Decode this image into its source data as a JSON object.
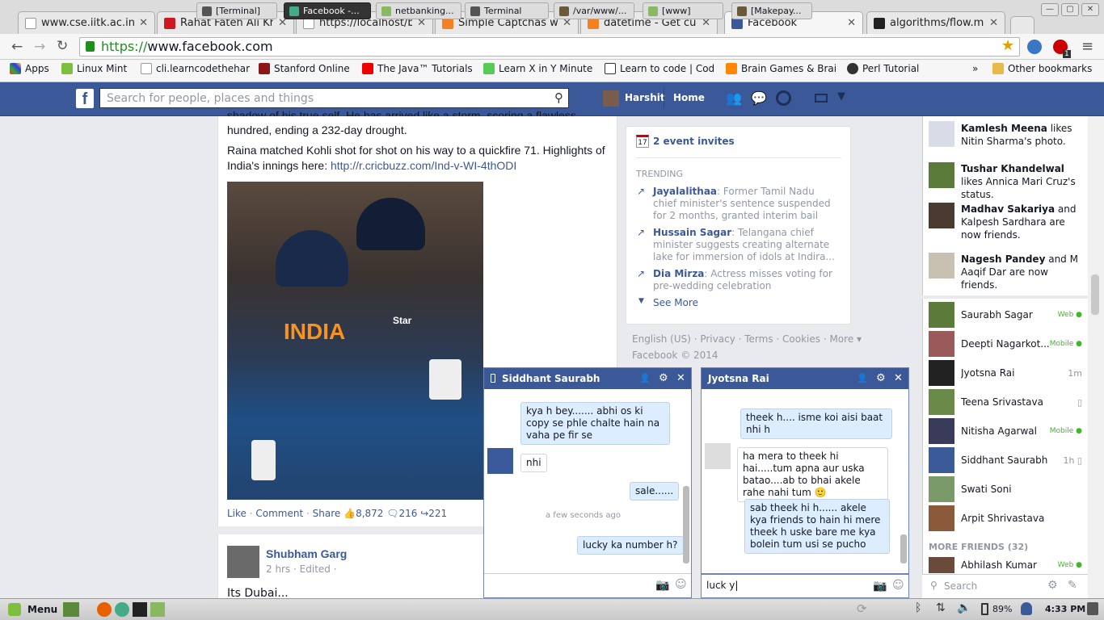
{
  "browser": {
    "tabs": [
      {
        "title": "www.cse.iitk.ac.in/u",
        "icon": "page-icon",
        "color": "#ffffff"
      },
      {
        "title": "Rahat Fateh Ali Khar",
        "icon": "youtube-icon",
        "color": "#cc181e"
      },
      {
        "title": "https://localhost/bar",
        "icon": "page-icon",
        "color": "#ffffff"
      },
      {
        "title": "Simple Captchas wit",
        "icon": "stackoverflow-icon",
        "color": "#f48024"
      },
      {
        "title": "datetime - Get curre",
        "icon": "stackoverflow-icon",
        "color": "#f48024"
      },
      {
        "title": "Facebook",
        "icon": "facebook-icon",
        "color": "#3b5998"
      },
      {
        "title": "algorithms/flow.mar",
        "icon": "github-icon",
        "color": "#222222"
      }
    ],
    "url_scheme": "https://",
    "url_host": "www.facebook.com",
    "bookmarks": [
      {
        "label": "Apps"
      },
      {
        "label": "Linux Mint"
      },
      {
        "label": "cli.learncodethehar"
      },
      {
        "label": "Stanford Online"
      },
      {
        "label": "The Java™ Tutorials"
      },
      {
        "label": "Learn X in Y Minute"
      },
      {
        "label": "Learn to code | Cod"
      },
      {
        "label": "Brain Games & Brai"
      },
      {
        "label": "Perl Tutorial"
      },
      {
        "label": "»"
      },
      {
        "label": "Other bookmarks"
      }
    ],
    "extension_badge": "1"
  },
  "fb_header": {
    "search_placeholder": "Search for people, places and things",
    "user_name": "Harshit",
    "home_label": "Home"
  },
  "post": {
    "partial_line1": "shadow of his true self. He has arrived like a storm, scoring a flawless",
    "partial_line2": "hundred, ending a 232-day drought.",
    "para2": "Raina matched Kohli shot for shot on his way to a quickfire 71. Highlights of India's innings here: ",
    "link": "http://r.cricbuzz.com/Ind-v-WI-4thODI",
    "like": "Like",
    "comment": "Comment",
    "share": "Share",
    "likes_count": "8,872",
    "comments_count": "216",
    "shares_count": "221",
    "jersey_text": "INDIA",
    "jersey_sponsor": "Star"
  },
  "next_post": {
    "author": "Shubham Garg",
    "meta": "2 hrs · Edited ·",
    "text": "Its Dubai..."
  },
  "right_col": {
    "event_date": "17",
    "event_invites": "2 event invites",
    "trending_title": "TRENDING",
    "trends": [
      {
        "name": "Jayalalithaa",
        "text": ": Former Tamil Nadu chief minister's sentence suspended for 2 months, granted interim bail"
      },
      {
        "name": "Hussain Sagar",
        "text": ": Telangana chief minister suggests creating alternate lake for immersion of idols at Indira..."
      },
      {
        "name": "Dia Mirza",
        "text": ": Actress misses voting for pre-wedding celebration"
      }
    ],
    "see_more": "See More",
    "footer_links": "English (US) · Privacy · Terms · Cookies · More ▾",
    "copyright": "Facebook © 2014"
  },
  "ticker": [
    {
      "name": "Kamlesh Meena",
      "text": " likes Nitin Sharma's photo."
    },
    {
      "name": "Tushar Khandelwal",
      "text": " likes Annica Mari Cruz's status."
    },
    {
      "name": "Madhav Sakariya",
      "text": " and Kalpesh Sardhara are now friends."
    },
    {
      "name": "Nagesh Pandey",
      "text": " and M Aaqif Dar are now friends."
    }
  ],
  "friends": [
    {
      "name": "Saurabh Sagar",
      "status": "Web ●",
      "grey": false
    },
    {
      "name": "Deepti Nagarkot...",
      "status": "Mobile ●",
      "grey": false
    },
    {
      "name": "Jyotsna Rai",
      "status": "1m",
      "grey": true
    },
    {
      "name": "Teena Srivastava",
      "status": "▯",
      "grey": true
    },
    {
      "name": "Nitisha Agarwal",
      "status": "Mobile ●",
      "grey": false
    },
    {
      "name": "Siddhant Saurabh",
      "status": "1h ▯",
      "grey": true
    },
    {
      "name": "Swati Soni",
      "status": "",
      "grey": true
    },
    {
      "name": "Arpit Shrivastava",
      "status": "",
      "grey": true
    }
  ],
  "more_friends": "MORE FRIENDS (32)",
  "more_friend": {
    "name": "Abhilash Kumar",
    "status": "Web ●"
  },
  "chat_search_placeholder": "Search",
  "chat1": {
    "name": "Siddhant Saurabh",
    "msg1": "kya h bey....... abhi os ki copy se phle chalte hain na vaha pe fir se",
    "msg2": "nhi",
    "msg3": "sale......",
    "time": "a few seconds ago",
    "msg4": "lucky ka number h?"
  },
  "chat2": {
    "name": "Jyotsna Rai",
    "msg1": "theek h.... isme koi aisi baat nhi h",
    "msg2": "ha mera to theek hi hai.....tum apna aur uska batao....ab to bhai akele rahe nahi tum 🙂",
    "msg3": "sab theek hi h...... akele kya friends to hain hi mere theek h uske bare me kya bolein tum usi se pucho",
    "input": "luck y"
  },
  "taskbar": {
    "menu": "Menu",
    "tasks": [
      "[Terminal]",
      "Facebook -...",
      "netbanking...",
      "Terminal",
      "/var/www/...",
      "[www]",
      "[Makepay..."
    ],
    "battery": "89%",
    "clock": "4:33 PM"
  }
}
